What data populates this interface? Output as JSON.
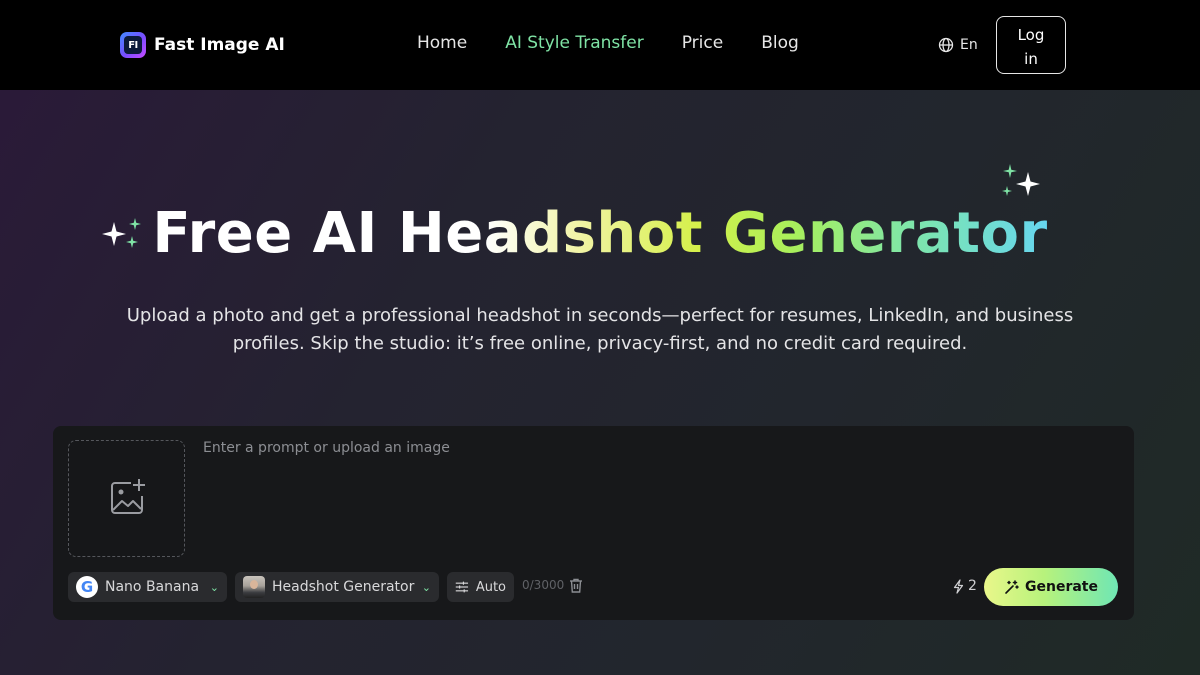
{
  "header": {
    "brand_mark": "FI",
    "brand_name": "Fast Image AI",
    "nav": [
      {
        "label": "Home",
        "active": false
      },
      {
        "label": "AI Style Transfer",
        "active": true
      },
      {
        "label": "Price",
        "active": false
      },
      {
        "label": "Blog",
        "active": false
      }
    ],
    "language": "En",
    "login_line1": "Log",
    "login_line2": "in"
  },
  "hero": {
    "title_white": "Free AI He",
    "title_gradient": "adshot Generator",
    "subtitle": "Upload a photo and get a professional headshot in seconds—perfect for resumes, LinkedIn, and business profiles. Skip the studio: it’s free online, privacy-first, and no credit card required."
  },
  "composer": {
    "prompt_placeholder": "Enter a prompt or upload an image",
    "model_label": "Nano Banana",
    "model_icon_letter": "G",
    "style_label": "Headshot Generator",
    "aspect_label": "Auto",
    "char_counter": "0/3000",
    "credits": "2",
    "generate_label": "Generate"
  },
  "colors": {
    "accent_green": "#7fe3a5",
    "header_bg": "#000000",
    "composer_bg": "#17181a"
  },
  "icons": [
    "sparkles-icon",
    "globe-icon",
    "image-add-icon",
    "google-icon",
    "chevron-down-icon",
    "sliders-icon",
    "trash-icon",
    "lightning-icon",
    "magic-wand-icon"
  ]
}
